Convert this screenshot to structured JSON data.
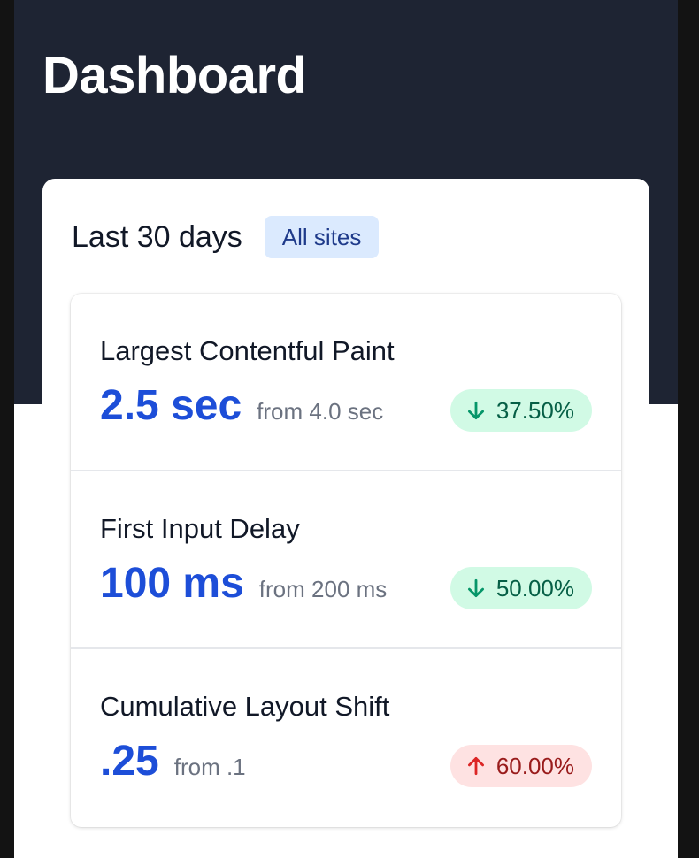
{
  "header": {
    "title": "Dashboard"
  },
  "panel": {
    "title": "Last 30 days",
    "scope_badge": "All sites"
  },
  "stats": [
    {
      "name": "Largest Contentful Paint",
      "value": "2.5 sec",
      "previous": "from 4.0 sec",
      "change": "37.50%",
      "direction": "down",
      "icon": "arrow-down-icon"
    },
    {
      "name": "First Input Delay",
      "value": "100 ms",
      "previous": "from 200 ms",
      "change": "50.00%",
      "direction": "down",
      "icon": "arrow-down-icon"
    },
    {
      "name": "Cumulative Layout Shift",
      "value": ".25",
      "previous": "from .1",
      "change": "60.00%",
      "direction": "up",
      "icon": "arrow-up-icon"
    }
  ],
  "colors": {
    "header_background": "#1e2433",
    "value_blue": "#1d4ed8",
    "decrease_badge_bg": "#d1fae5",
    "decrease_badge_text": "#065f46",
    "increase_badge_bg": "#fee2e2",
    "increase_badge_text": "#991b1b",
    "scope_badge_bg": "#dbeafe"
  }
}
